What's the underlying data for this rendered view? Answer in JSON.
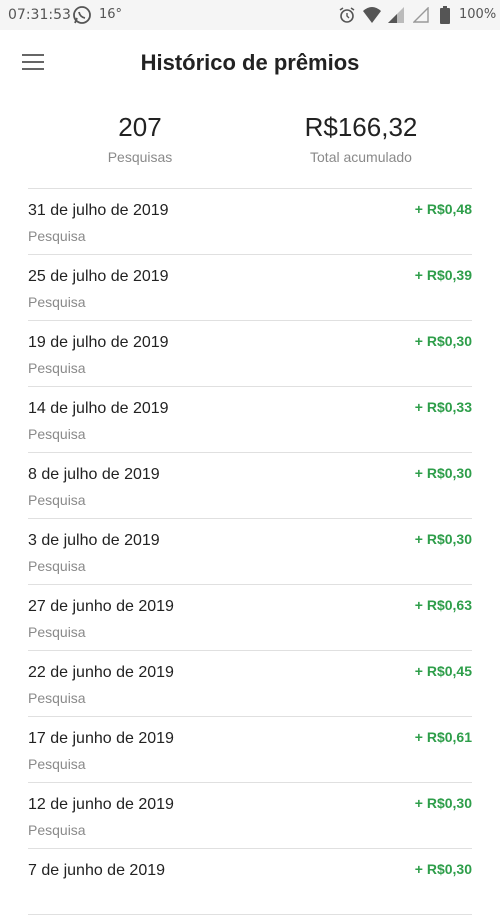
{
  "status_bar": {
    "time": "07:31:53",
    "temperature": "16°",
    "battery": "100%"
  },
  "header": {
    "title": "Histórico de prêmios"
  },
  "summary": {
    "surveys_count": "207",
    "surveys_label": "Pesquisas",
    "total": "R$166,32",
    "total_label": "Total acumulado"
  },
  "rewards": [
    {
      "date": "31 de julho de 2019",
      "type": "Pesquisa",
      "amount": "+ R$0,48"
    },
    {
      "date": "25 de julho de 2019",
      "type": "Pesquisa",
      "amount": "+ R$0,39"
    },
    {
      "date": "19 de julho de 2019",
      "type": "Pesquisa",
      "amount": "+ R$0,30"
    },
    {
      "date": "14 de julho de 2019",
      "type": "Pesquisa",
      "amount": "+ R$0,33"
    },
    {
      "date": "8 de julho de 2019",
      "type": "Pesquisa",
      "amount": "+ R$0,30"
    },
    {
      "date": "3 de julho de 2019",
      "type": "Pesquisa",
      "amount": "+ R$0,30"
    },
    {
      "date": "27 de junho de 2019",
      "type": "Pesquisa",
      "amount": "+ R$0,63"
    },
    {
      "date": "22 de junho de 2019",
      "type": "Pesquisa",
      "amount": "+ R$0,45"
    },
    {
      "date": "17 de junho de 2019",
      "type": "Pesquisa",
      "amount": "+ R$0,61"
    },
    {
      "date": "12 de junho de 2019",
      "type": "Pesquisa",
      "amount": "+ R$0,30"
    },
    {
      "date": "7 de junho de 2019",
      "type": "",
      "amount": "+ R$0,30"
    }
  ],
  "colors": {
    "positive_amount": "#2e9e4a"
  },
  "icons": [
    "whatsapp-icon",
    "alarm-icon",
    "wifi-icon",
    "signal-icon",
    "battery-icon",
    "menu-icon"
  ]
}
